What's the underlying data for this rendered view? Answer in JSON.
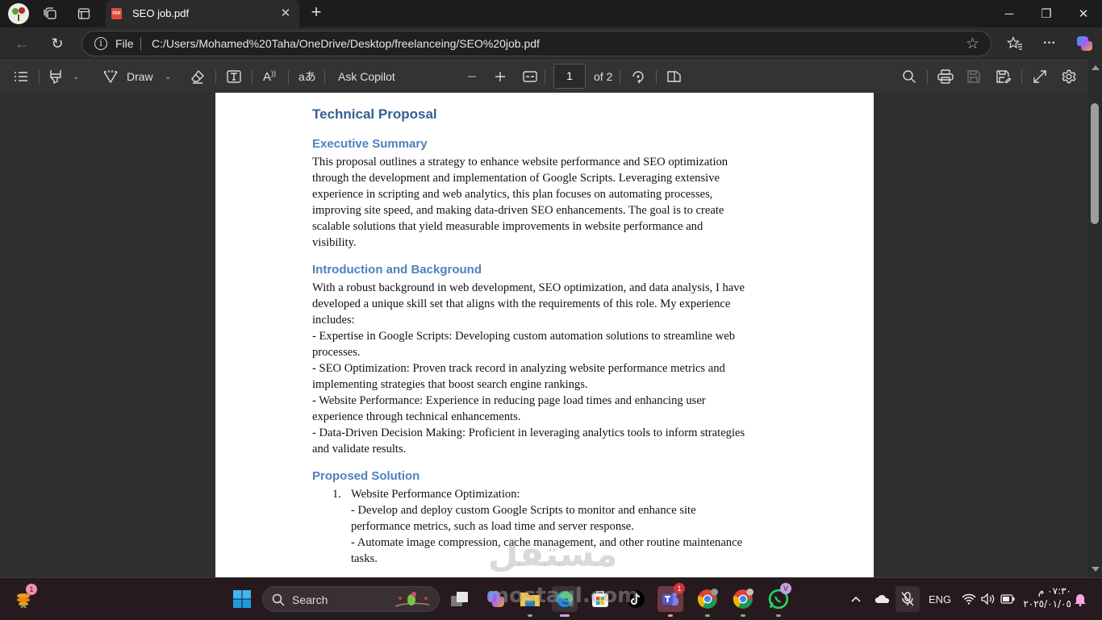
{
  "browser": {
    "tab": {
      "title": "SEO job.pdf",
      "file_badge": "PDF"
    },
    "address": {
      "scheme_label": "File",
      "url": "C:/Users/Mohamed%20Taha/OneDrive/Desktop/freelanceing/SEO%20job.pdf"
    }
  },
  "icons": {
    "close": "✕",
    "plus": "+",
    "minimize": "─",
    "restore": "❐",
    "star": "☆",
    "more": "···",
    "back": "←",
    "reload": "↻"
  },
  "pdf_toolbar": {
    "draw_label": "Draw",
    "ask_copilot_label": "Ask Copilot",
    "current_page": "1",
    "page_total_label": "of 2"
  },
  "document": {
    "title": "Technical Proposal",
    "sections": [
      {
        "heading": "Executive Summary",
        "body": "This proposal outlines a strategy to enhance website performance and SEO optimization\nthrough the development and implementation of Google Scripts. Leveraging extensive\nexperience in scripting and web analytics, this plan focuses on automating processes,\nimproving site speed, and making data-driven SEO enhancements. The goal is to create\nscalable solutions that yield measurable improvements in website performance and\nvisibility."
      },
      {
        "heading": "Introduction and Background",
        "body": "With a robust background in web development, SEO optimization, and data analysis, I have\ndeveloped a unique skill set that aligns with the requirements of this role. My experience\nincludes:\n- Expertise in Google Scripts: Developing custom automation solutions to streamline web\nprocesses.\n- SEO Optimization: Proven track record in analyzing website performance metrics and\nimplementing strategies that boost search engine rankings.\n- Website Performance: Experience in reducing page load times and enhancing user\nexperience through technical enhancements.\n- Data-Driven Decision Making: Proficient in leveraging analytics tools to inform strategies\nand validate results."
      },
      {
        "heading": "Proposed Solution",
        "list": [
          {
            "number": "1.",
            "text": "Website Performance Optimization:\n- Develop and deploy custom Google Scripts to monitor and enhance site\nperformance metrics, such as load time and server response.\n- Automate image compression, cache management, and other routine maintenance\ntasks."
          }
        ]
      }
    ]
  },
  "watermark": {
    "arabic": "مستقل",
    "latin": "mostaql.com"
  },
  "taskbar": {
    "search_label": "Search",
    "widget_badge": "1",
    "teams_badge": "1",
    "whatsapp_badge": "V",
    "language": "ENG",
    "time": "٠٧:٣٠ م",
    "date": "٢٠٢٥/٠١/٠٥"
  }
}
